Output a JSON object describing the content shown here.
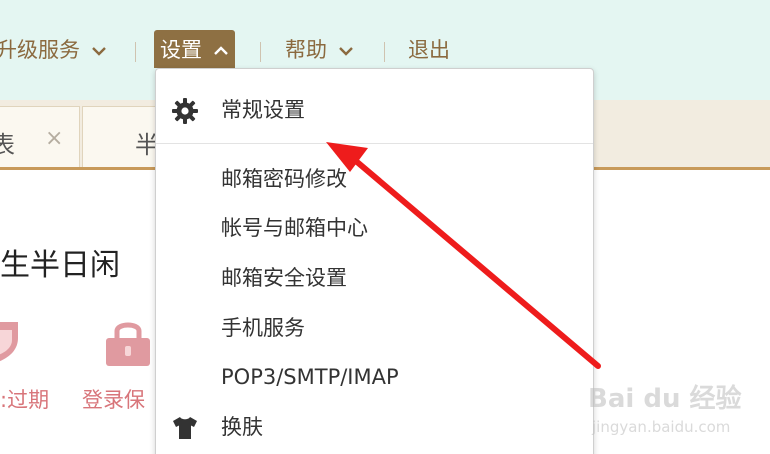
{
  "nav": {
    "upgrade": "升级服务",
    "settings": "设置",
    "help": "帮助",
    "logout": "退出"
  },
  "tabs": [
    {
      "text": "表",
      "close": "×"
    },
    {
      "text": "半"
    }
  ],
  "main": {
    "greeting": "生半日闲",
    "status_expired": ":过期",
    "login_protect": "登录保"
  },
  "dropdown": {
    "items": [
      {
        "label": "常规设置",
        "icon": "gear-icon"
      },
      {
        "label": "邮箱密码修改"
      },
      {
        "label": "帐号与邮箱中心"
      },
      {
        "label": "邮箱安全设置"
      },
      {
        "label": "手机服务"
      },
      {
        "label": "POP3/SMTP/IMAP"
      },
      {
        "label": "换肤",
        "icon": "tshirt-icon"
      }
    ]
  },
  "watermark": {
    "main": "Bai du 经验",
    "sub": "jingyan.baidu.com"
  },
  "colors": {
    "header_bg": "#e4f6f2",
    "nav_text": "#8b6a3f",
    "nav_active_bg": "#8e7043",
    "tab_border": "#c89a5a",
    "status_pink": "#d8757a",
    "arrow_red": "#ee1c1c"
  }
}
